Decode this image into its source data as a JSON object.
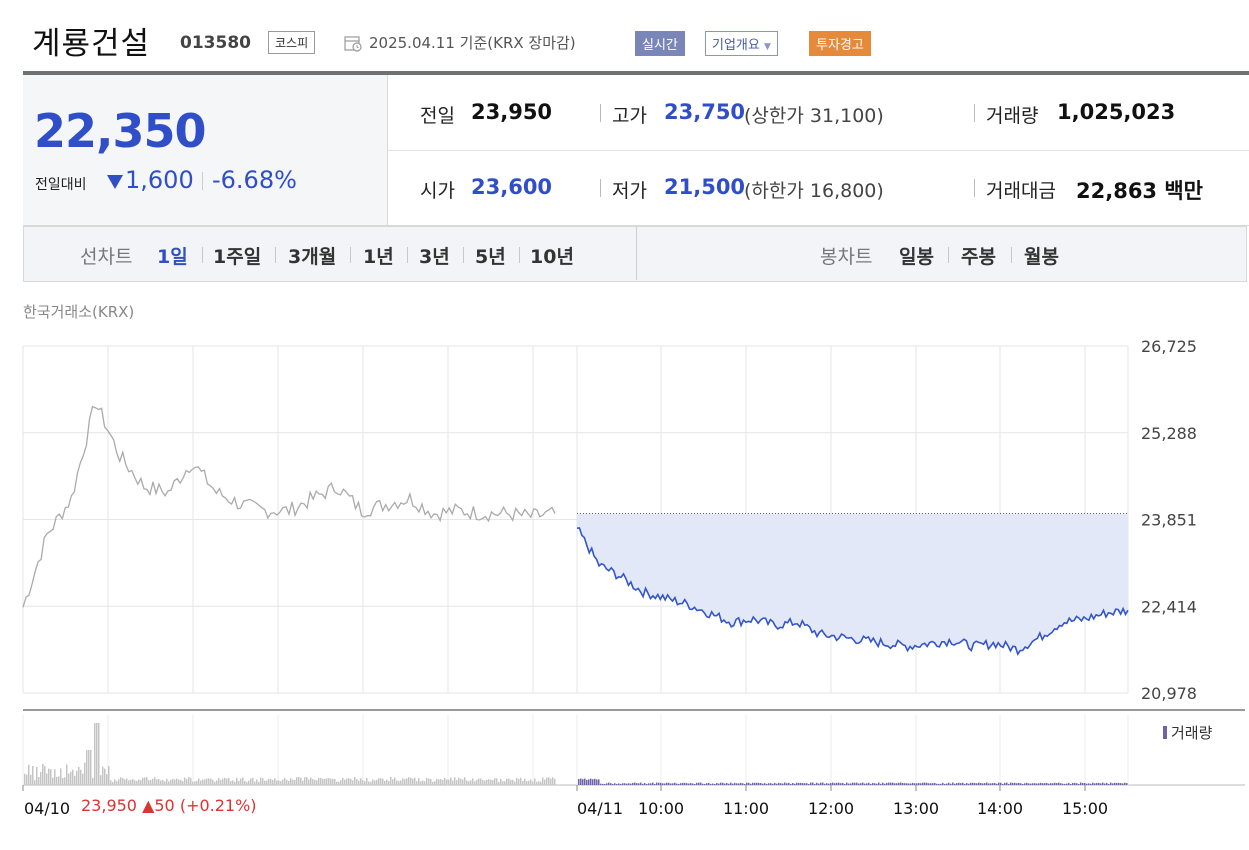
{
  "header": {
    "stock_name": "계룡건설",
    "stock_code": "013580",
    "market": "코스피",
    "date_text": "2025.04.11 기준(KRX 장마감)",
    "realtime_button": "실시간",
    "overview_button": "기업개요",
    "warning_badge": "투자경고"
  },
  "price": {
    "current": "22,350",
    "change_label": "전일대비",
    "change_amount": "1,600",
    "change_percent": "-6.68%",
    "direction": "down"
  },
  "stats": {
    "prev_label": "전일",
    "prev_value": "23,950",
    "high_label": "고가",
    "high_value": "23,750",
    "upper_limit": "(상한가 31,100)",
    "volume_label": "거래량",
    "volume_value": "1,025,023",
    "open_label": "시가",
    "open_value": "23,600",
    "low_label": "저가",
    "low_value": "21,500",
    "lower_limit": "(하한가 16,800)",
    "amount_label": "거래대금",
    "amount_value": "22,863 백만"
  },
  "periods": {
    "line_label": "선차트",
    "line_items": [
      "1일",
      "1주일",
      "3개월",
      "1년",
      "3년",
      "5년",
      "10년"
    ],
    "active": "1일",
    "candle_label": "봉차트",
    "candle_items": [
      "일봉",
      "주봉",
      "월봉"
    ]
  },
  "chart_source": "한국거래소(KRX)",
  "chart_data": {
    "type": "line",
    "y_ticks": [
      "26,725",
      "25,288",
      "23,851",
      "22,414",
      "20,978"
    ],
    "ylim": [
      20978,
      26725
    ],
    "x_ticks": [
      "04/10",
      "04/11",
      "10:00",
      "11:00",
      "12:00",
      "13:00",
      "14:00",
      "15:00"
    ],
    "reference_price": 23950,
    "series": [
      {
        "color": "#aaaaaa",
        "x": [
          "04/10 09:00",
          "09:15",
          "09:30",
          "09:45",
          "10:00",
          "10:15",
          "10:30",
          "10:45",
          "11:00",
          "11:15",
          "11:30",
          "11:45",
          "12:00",
          "12:20",
          "12:40",
          "13:00",
          "13:20",
          "13:40",
          "14:00",
          "14:20",
          "14:40",
          "15:00",
          "15:20"
        ],
        "values": [
          22400,
          23600,
          24200,
          25800,
          24900,
          24400,
          24300,
          24800,
          24300,
          24100,
          24000,
          24000,
          24200,
          24400,
          24000,
          24100,
          24200,
          23950,
          24000,
          23950,
          23950,
          23900,
          23950
        ]
      },
      {
        "color": "#3355cc",
        "x": [
          "04/11 09:00",
          "09:05",
          "09:10",
          "09:15",
          "09:20",
          "09:30",
          "09:40",
          "09:50",
          "10:00",
          "10:10",
          "10:20",
          "10:40",
          "11:00",
          "11:20",
          "11:40",
          "12:00",
          "12:20",
          "12:40",
          "13:00",
          "13:20",
          "13:40",
          "14:00",
          "14:20",
          "14:40",
          "15:00",
          "15:20"
        ],
        "values": [
          23700,
          23100,
          22900,
          22650,
          22550,
          22450,
          22300,
          22150,
          22200,
          22100,
          22150,
          21950,
          21900,
          21850,
          21800,
          21750,
          21800,
          21850,
          21750,
          21800,
          21700,
          21900,
          22150,
          22200,
          22300,
          22350
        ]
      }
    ],
    "volume": {
      "label": "거래량"
    }
  },
  "prev_close_info": "23,950 ▲50 (+0.21%)"
}
